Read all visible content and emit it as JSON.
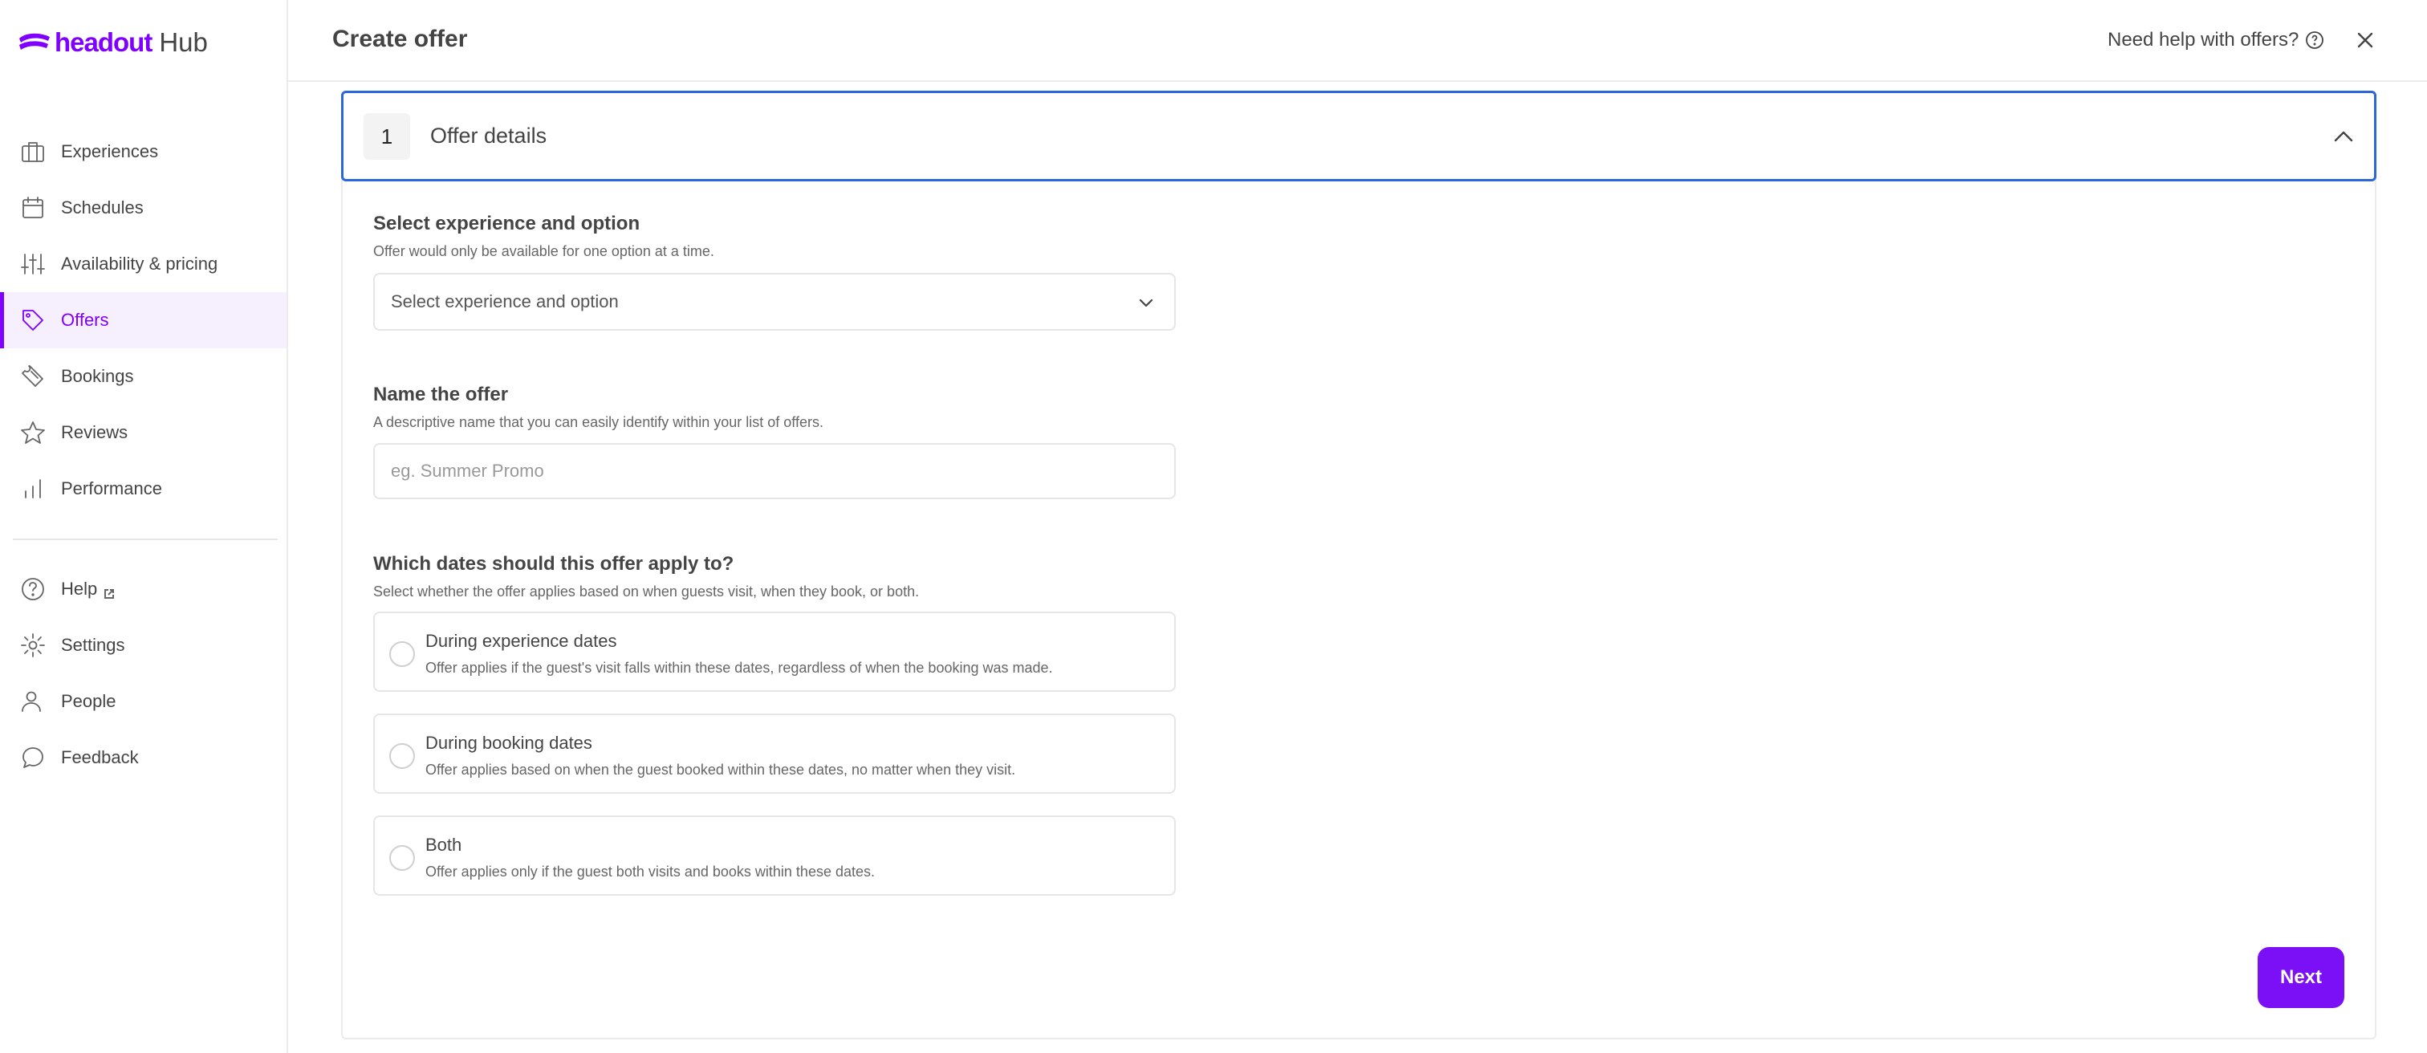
{
  "app": {
    "brand": "headout",
    "product": "Hub"
  },
  "sidebar": {
    "items": [
      {
        "label": "Experiences",
        "icon": "briefcase-icon"
      },
      {
        "label": "Schedules",
        "icon": "calendar-icon"
      },
      {
        "label": "Availability & pricing",
        "icon": "sliders-icon"
      },
      {
        "label": "Offers",
        "icon": "tag-icon",
        "active": true
      },
      {
        "label": "Bookings",
        "icon": "ticket-icon"
      },
      {
        "label": "Reviews",
        "icon": "star-icon"
      },
      {
        "label": "Performance",
        "icon": "bar-chart-icon"
      }
    ],
    "secondary": [
      {
        "label": "Help",
        "icon": "help-circle-icon"
      },
      {
        "label": "Settings",
        "icon": "gear-icon"
      },
      {
        "label": "People",
        "icon": "user-icon"
      },
      {
        "label": "Feedback",
        "icon": "chat-bubble-icon"
      }
    ]
  },
  "header": {
    "title": "Create offer",
    "help_link": "Need help with offers?"
  },
  "step": {
    "number": "1",
    "title": "Offer details"
  },
  "form": {
    "experience": {
      "label": "Select experience and option",
      "help": "Offer would only be available for one option at a time.",
      "placeholder": "Select experience and option"
    },
    "name": {
      "label": "Name the offer",
      "help": "A descriptive name that you can easily identify within your list of offers.",
      "placeholder": "eg. Summer Promo",
      "value": ""
    },
    "dates": {
      "label": "Which dates should this offer apply to?",
      "help": "Select whether the offer applies based on when guests visit, when they book, or both.",
      "options": [
        {
          "title": "During experience dates",
          "desc": "Offer applies if the guest's visit falls within these dates, regardless of when the booking was made."
        },
        {
          "title": "During booking dates",
          "desc": "Offer applies based on when the guest booked within these dates, no matter when they visit."
        },
        {
          "title": "Both",
          "desc": "Offer applies only if the guest both visits and books within these dates."
        }
      ]
    }
  },
  "actions": {
    "next": "Next"
  },
  "colors": {
    "accent": "#8000ff",
    "button": "#7b0ff5",
    "focus_border": "#2b67d8"
  }
}
